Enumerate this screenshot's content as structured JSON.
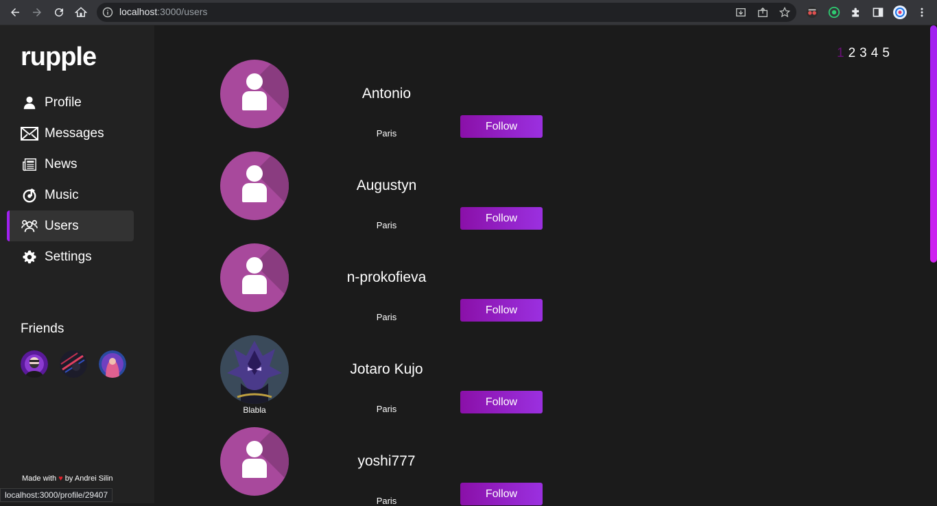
{
  "browser": {
    "url_host": "localhost",
    "url_path": ":3000/users"
  },
  "sidebar": {
    "logo": "rupple",
    "items": [
      {
        "label": "Profile",
        "icon": "person-icon"
      },
      {
        "label": "Messages",
        "icon": "envelope-icon"
      },
      {
        "label": "News",
        "icon": "newspaper-icon"
      },
      {
        "label": "Music",
        "icon": "music-icon"
      },
      {
        "label": "Users",
        "icon": "users-icon",
        "active": true
      },
      {
        "label": "Settings",
        "icon": "gear-icon"
      }
    ],
    "friends_title": "Friends",
    "made_with_prefix": "Made with",
    "made_with_heart": "♥",
    "made_with_suffix": "by Andrei Silin"
  },
  "status_tooltip": "localhost:3000/profile/29407",
  "pagination": {
    "pages": [
      "1",
      "2",
      "3",
      "4",
      "5"
    ],
    "current": "1"
  },
  "users": [
    {
      "name": "Antonio",
      "city": "Paris",
      "follow_label": "Follow"
    },
    {
      "name": "Augustyn",
      "city": "Paris",
      "follow_label": "Follow"
    },
    {
      "name": "n-prokofieva",
      "city": "Paris",
      "follow_label": "Follow"
    },
    {
      "name": "Jotaro Kujo",
      "city": "Paris",
      "follow_label": "Follow",
      "photo_caption": "Blabla"
    },
    {
      "name": "yoshi777",
      "city": "Paris",
      "follow_label": "Follow"
    }
  ],
  "colors": {
    "accent": "#a020f0",
    "avatar_bg": "#a8499c",
    "button_start": "#8a10a8",
    "button_end": "#9b30e0"
  }
}
